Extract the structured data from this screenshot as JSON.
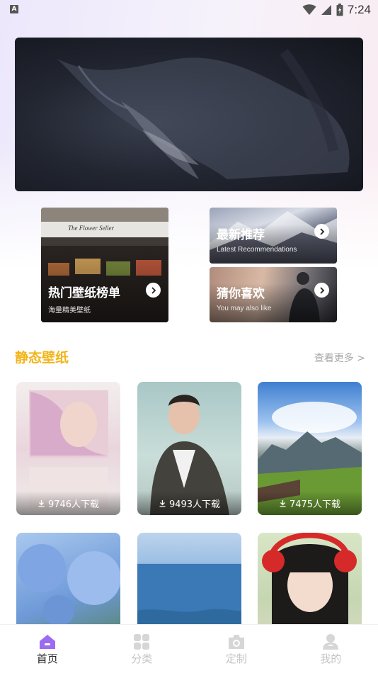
{
  "status_bar": {
    "time": "7:24",
    "indicator": "A",
    "icons": [
      "wifi-icon",
      "signal-icon",
      "battery-icon"
    ]
  },
  "banner": {
    "image": "dark-creature-artwork"
  },
  "features": {
    "hot": {
      "title": "热门壁纸榜单",
      "subtitle": "海量精美壁纸",
      "sign": "The Flower Seller"
    },
    "latest": {
      "title": "最新推荐",
      "subtitle": "Latest Recommendations"
    },
    "guess": {
      "title": "猜你喜欢",
      "subtitle": "You may also like"
    }
  },
  "section": {
    "title": "静态壁纸",
    "more": "查看更多 >"
  },
  "wallpapers": [
    {
      "downloads": "9746人下载",
      "image": "illustrated-girl-painting"
    },
    {
      "downloads": "9493人下载",
      "image": "young-man-jacket"
    },
    {
      "downloads": "7475人下载",
      "image": "alpine-mountains-landscape"
    },
    {
      "image": "blue-hydrangea-flowers"
    },
    {
      "image": "ocean-horizon"
    },
    {
      "image": "girl-with-red-headphones"
    }
  ],
  "nav": [
    {
      "label": "首页",
      "icon": "home-icon",
      "active": true
    },
    {
      "label": "分类",
      "icon": "grid-icon",
      "active": false
    },
    {
      "label": "定制",
      "icon": "camera-icon",
      "active": false
    },
    {
      "label": "我的",
      "icon": "profile-icon",
      "active": false
    }
  ],
  "colors": {
    "accent": "#f3b51c",
    "nav_active": "#9b6cf0",
    "nav_inactive": "#d6d6d6"
  }
}
